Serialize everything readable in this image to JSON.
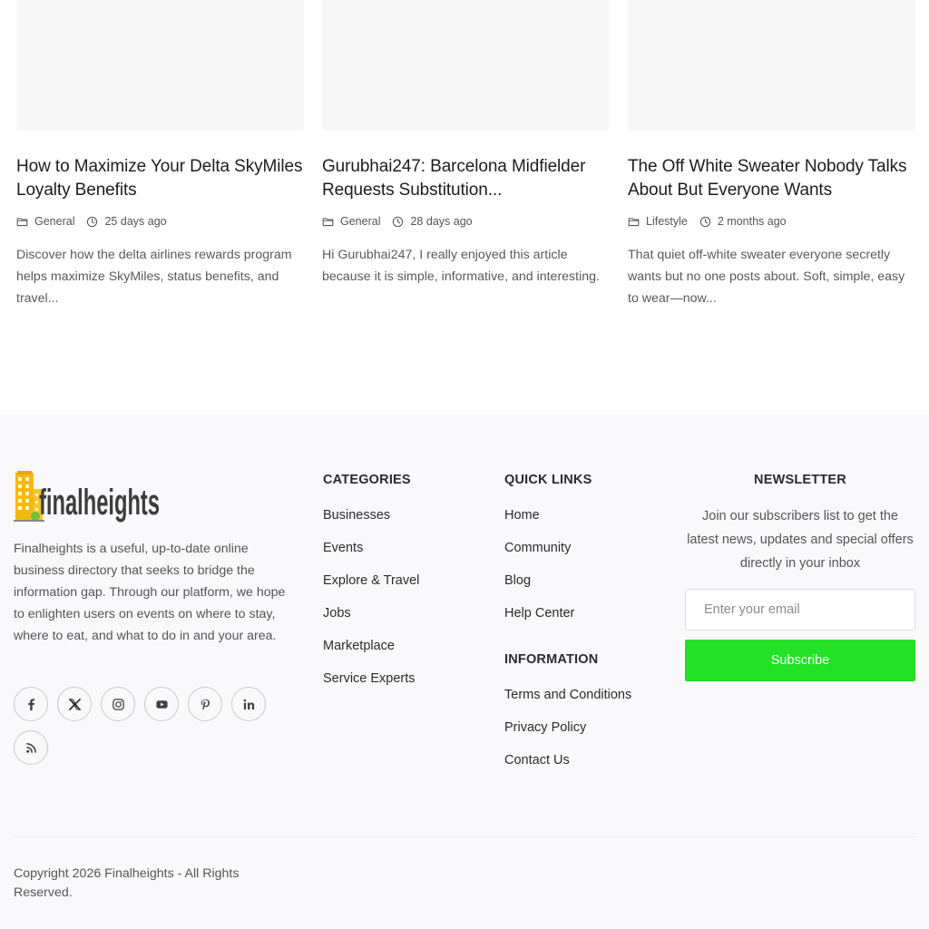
{
  "articles": [
    {
      "title": "How to Maximize Your Delta SkyMiles Loyalty Benefits",
      "category": "General",
      "date": "25 days ago",
      "excerpt": "Discover how the delta airlines rewards program helps maximize SkyMiles, status benefits, and travel..."
    },
    {
      "title": "Gurubhai247: Barcelona Midfielder Requests Substitution...",
      "category": "General",
      "date": "28 days ago",
      "excerpt": "Hi Gurubhai247, I really enjoyed this article because it is simple, informative, and interesting."
    },
    {
      "title": "The Off White Sweater Nobody Talks About But Everyone Wants",
      "category": "Lifestyle",
      "date": "2 months ago",
      "excerpt": "That quiet off-white sweater everyone secretly wants but no one posts about. Soft, simple, easy to wear—now..."
    }
  ],
  "footer": {
    "logo_text": "finalheights",
    "about": "Finalheights is a useful, up-to-date online business directory that seeks to bridge the information gap. Through our platform, we hope to enlighten users on events on where to stay, where to eat, and what to do in and your area.",
    "socials": [
      "facebook-icon",
      "x-icon",
      "instagram-icon",
      "youtube-icon",
      "pinterest-icon",
      "linkedin-icon",
      "rss-icon"
    ],
    "categories": {
      "heading": "CATEGORIES",
      "items": [
        "Businesses",
        "Events",
        "Explore & Travel",
        "Jobs",
        "Marketplace",
        "Service Experts"
      ]
    },
    "quick_links": {
      "heading": "QUICK LINKS",
      "items": [
        "Home",
        "Community",
        "Blog",
        "Help Center"
      ]
    },
    "information": {
      "heading": "INFORMATION",
      "items": [
        "Terms and Conditions",
        "Privacy Policy",
        "Contact Us"
      ]
    },
    "newsletter": {
      "heading": "NEWSLETTER",
      "text": "Join our subscribers list to get the latest news, updates and special offers directly in your inbox",
      "placeholder": "Enter your email",
      "button": "Subscribe",
      "button_color": "#22e126"
    },
    "copyright": "Copyright 2026 Finalheights - All Rights Reserved."
  }
}
